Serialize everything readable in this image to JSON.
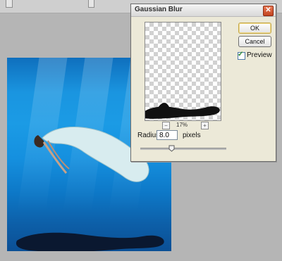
{
  "dialog": {
    "title": "Gaussian Blur",
    "ok_label": "OK",
    "cancel_label": "Cancel",
    "preview_label": "Preview",
    "preview_checked": true,
    "zoom_label": "17%",
    "radius_label": "Radius:",
    "radius_value": "8.0",
    "radius_unit": "pixels",
    "slider_fraction": 0.33
  },
  "icons": {
    "close": "close-icon",
    "zoom_out": "zoom-out-icon",
    "zoom_in": "zoom-in-icon",
    "slider_thumb": "slider-thumb-icon",
    "preview_check": "checkmark-icon"
  },
  "colors": {
    "dialog_bg": "#ece9d8",
    "close_button": "#c2441f",
    "water_blue": "#1b9be5"
  }
}
